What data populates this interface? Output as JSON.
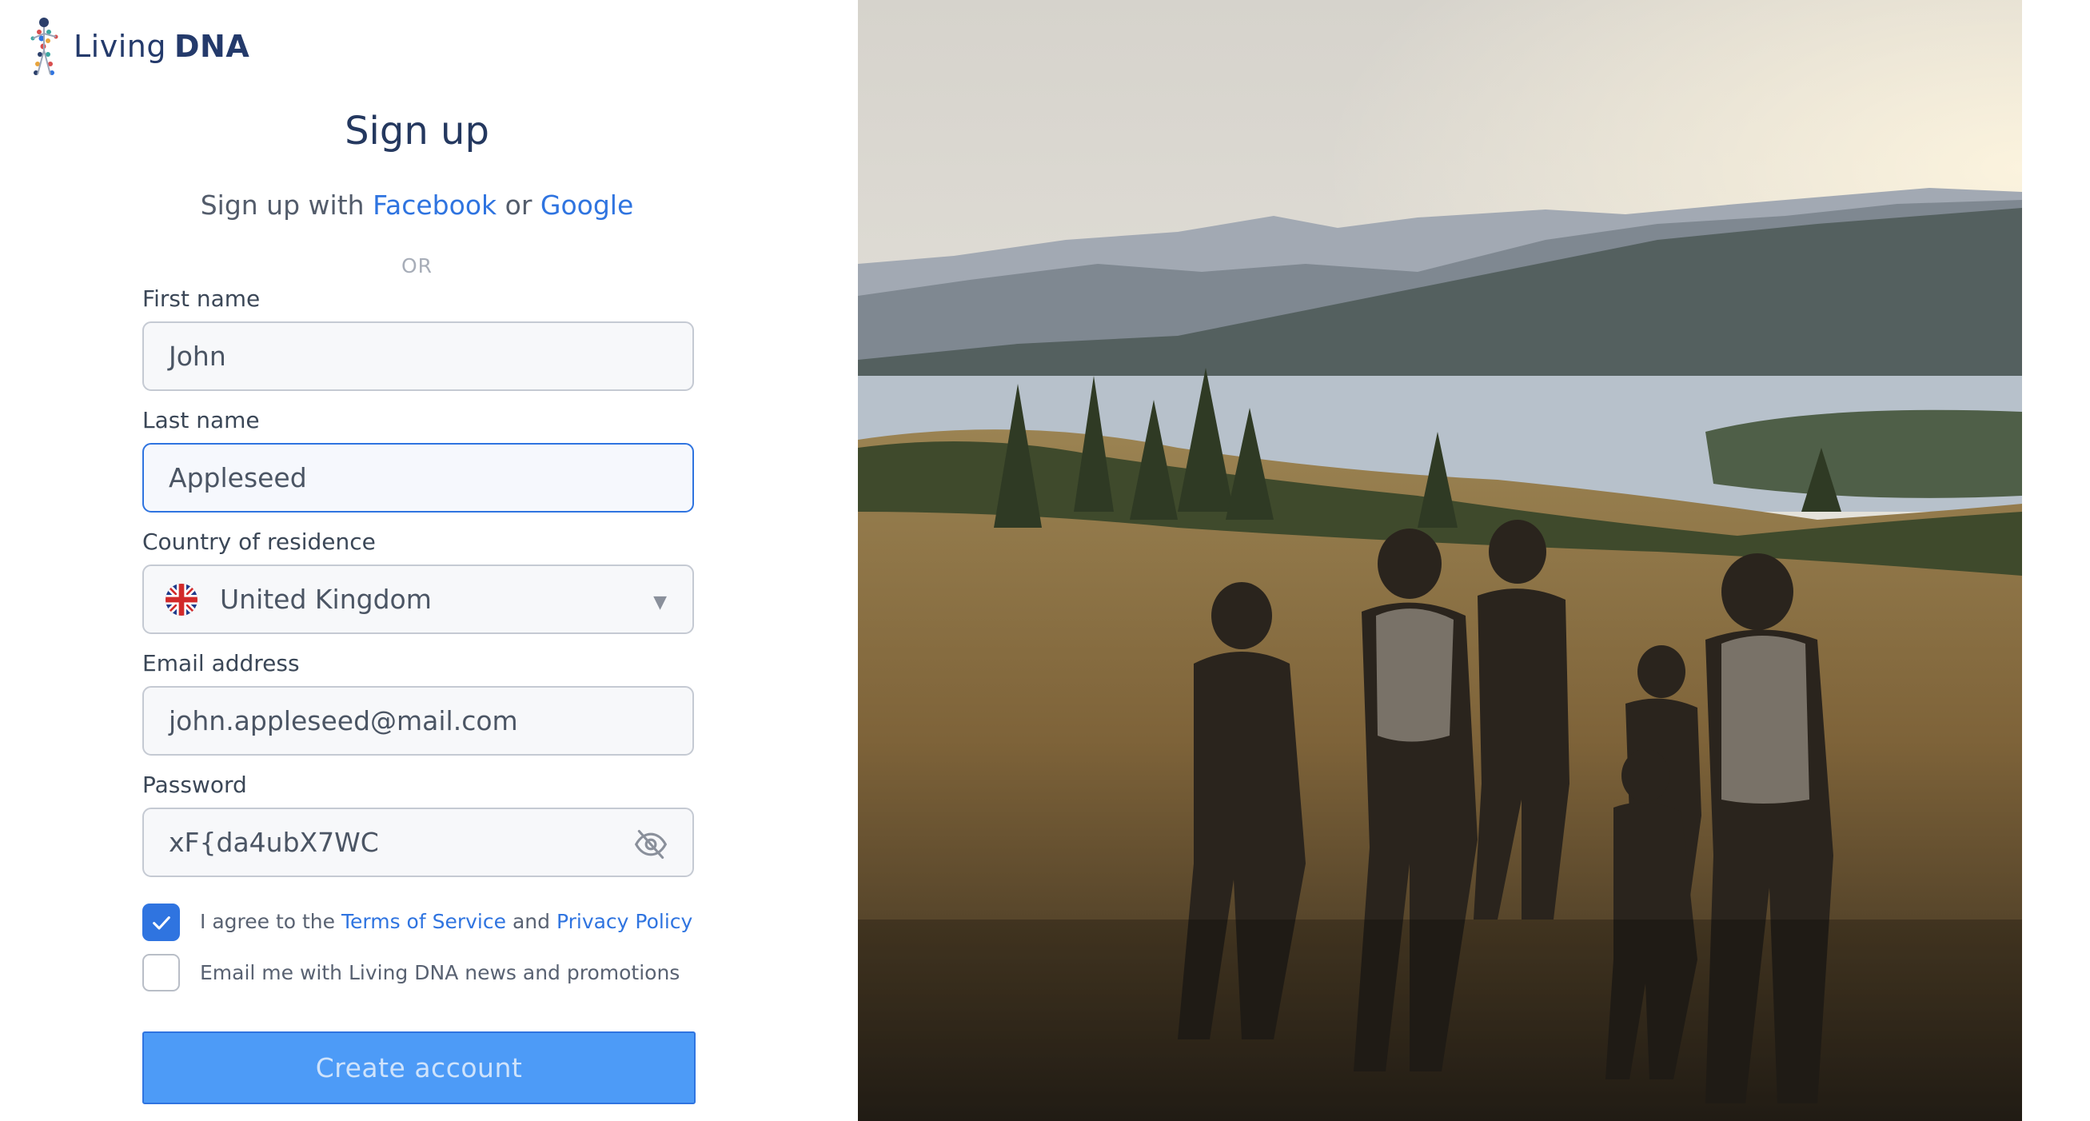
{
  "brand": {
    "name_light": "Living",
    "name_bold": "DNA",
    "logo_icon": "dna-figure-icon"
  },
  "page": {
    "title": "Sign up"
  },
  "social": {
    "prefix": "Sign up with",
    "facebook": "Facebook",
    "or": "or",
    "google": "Google"
  },
  "divider": "OR",
  "form": {
    "first_name": {
      "label": "First name",
      "value": "John"
    },
    "last_name": {
      "label": "Last name",
      "value": "Appleseed"
    },
    "country": {
      "label": "Country of residence",
      "value": "United Kingdom",
      "flag_icon": "uk-flag-icon"
    },
    "email": {
      "label": "Email address",
      "value": "john.appleseed@mail.com"
    },
    "password": {
      "label": "Password",
      "value": "xF{da4ubX7WC",
      "toggle_icon": "eye-off-icon"
    }
  },
  "consent": {
    "terms_checked": true,
    "terms_prefix": "I agree to the",
    "terms_link": "Terms of Service",
    "terms_and": "and",
    "privacy_link": "Privacy Policy",
    "news_checked": false,
    "news_text": "Email me with Living DNA news and promotions"
  },
  "submit_label": "Create account",
  "colors": {
    "accent": "#2f74e0",
    "button": "#4d9bf7",
    "heading": "#24385f"
  },
  "hero_image": "family-hiking-landscape-photo"
}
